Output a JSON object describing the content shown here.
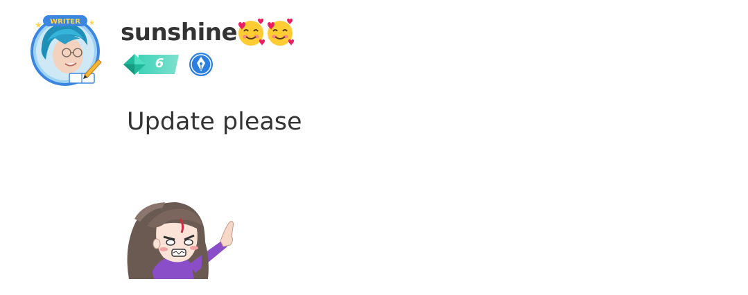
{
  "comment": {
    "username": "sunshine",
    "username_emojis": [
      "smiling-face-with-hearts",
      "smiling-face-with-hearts"
    ],
    "avatar_frame_label": "WRITER",
    "level": "6",
    "badges": [
      "level-badge",
      "writer-pen-badge"
    ],
    "text": "Update please",
    "sticker": "angry-girl-pointing-sticker"
  },
  "colors": {
    "level_badge": "#2ec4a6",
    "writer_badge": "#2b7fe0",
    "avatar_frame": "#3a86e0",
    "text": "#333333"
  }
}
